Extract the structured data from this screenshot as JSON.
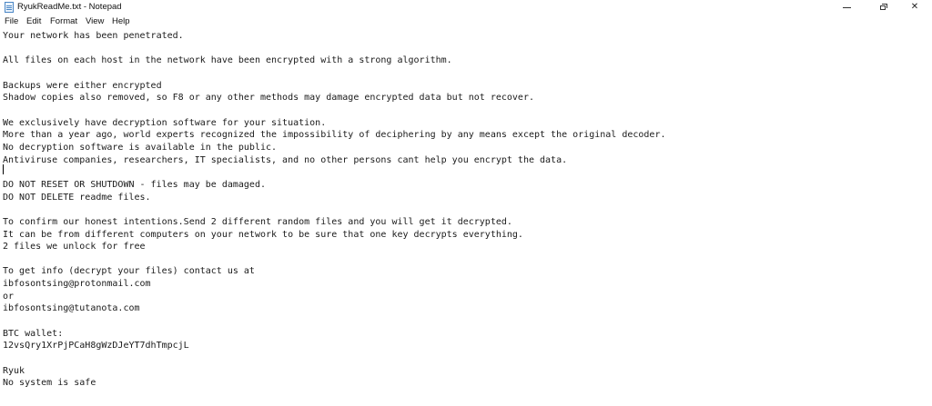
{
  "window": {
    "title": "RyukReadMe.txt - Notepad",
    "app_icon": "notepad-icon",
    "controls": {
      "minimize_icon": "minimize-icon",
      "maximize_icon": "restore-icon",
      "close_icon": "close-icon",
      "close_glyph": "✕"
    }
  },
  "menu": {
    "items": [
      {
        "label": "File"
      },
      {
        "label": "Edit"
      },
      {
        "label": "Format"
      },
      {
        "label": "View"
      },
      {
        "label": "Help"
      }
    ]
  },
  "editor": {
    "lines": [
      "Your network has been penetrated.",
      "",
      "All files on each host in the network have been encrypted with a strong algorithm.",
      "",
      "Backups were either encrypted",
      "Shadow copies also removed, so F8 or any other methods may damage encrypted data but not recover.",
      "",
      "We exclusively have decryption software for your situation.",
      "More than a year ago, world experts recognized the impossibility of deciphering by any means except the original decoder.",
      "No decryption software is available in the public.",
      "Antiviruse companies, researchers, IT specialists, and no other persons cant help you encrypt the data.",
      "",
      "DO NOT RESET OR SHUTDOWN - files may be damaged.",
      "DO NOT DELETE readme files.",
      "",
      "To confirm our honest intentions.Send 2 different random files and you will get it decrypted.",
      "It can be from different computers on your network to be sure that one key decrypts everything.",
      "2 files we unlock for free",
      "",
      "To get info (decrypt your files) contact us at",
      "ibfosontsing@protonmail.com",
      "or",
      "ibfosontsing@tutanota.com",
      "",
      "BTC wallet:",
      "12vsQry1XrPjPCaH8gWzDJeYT7dhTmpcjL",
      "",
      "Ryuk",
      "No system is safe"
    ]
  }
}
